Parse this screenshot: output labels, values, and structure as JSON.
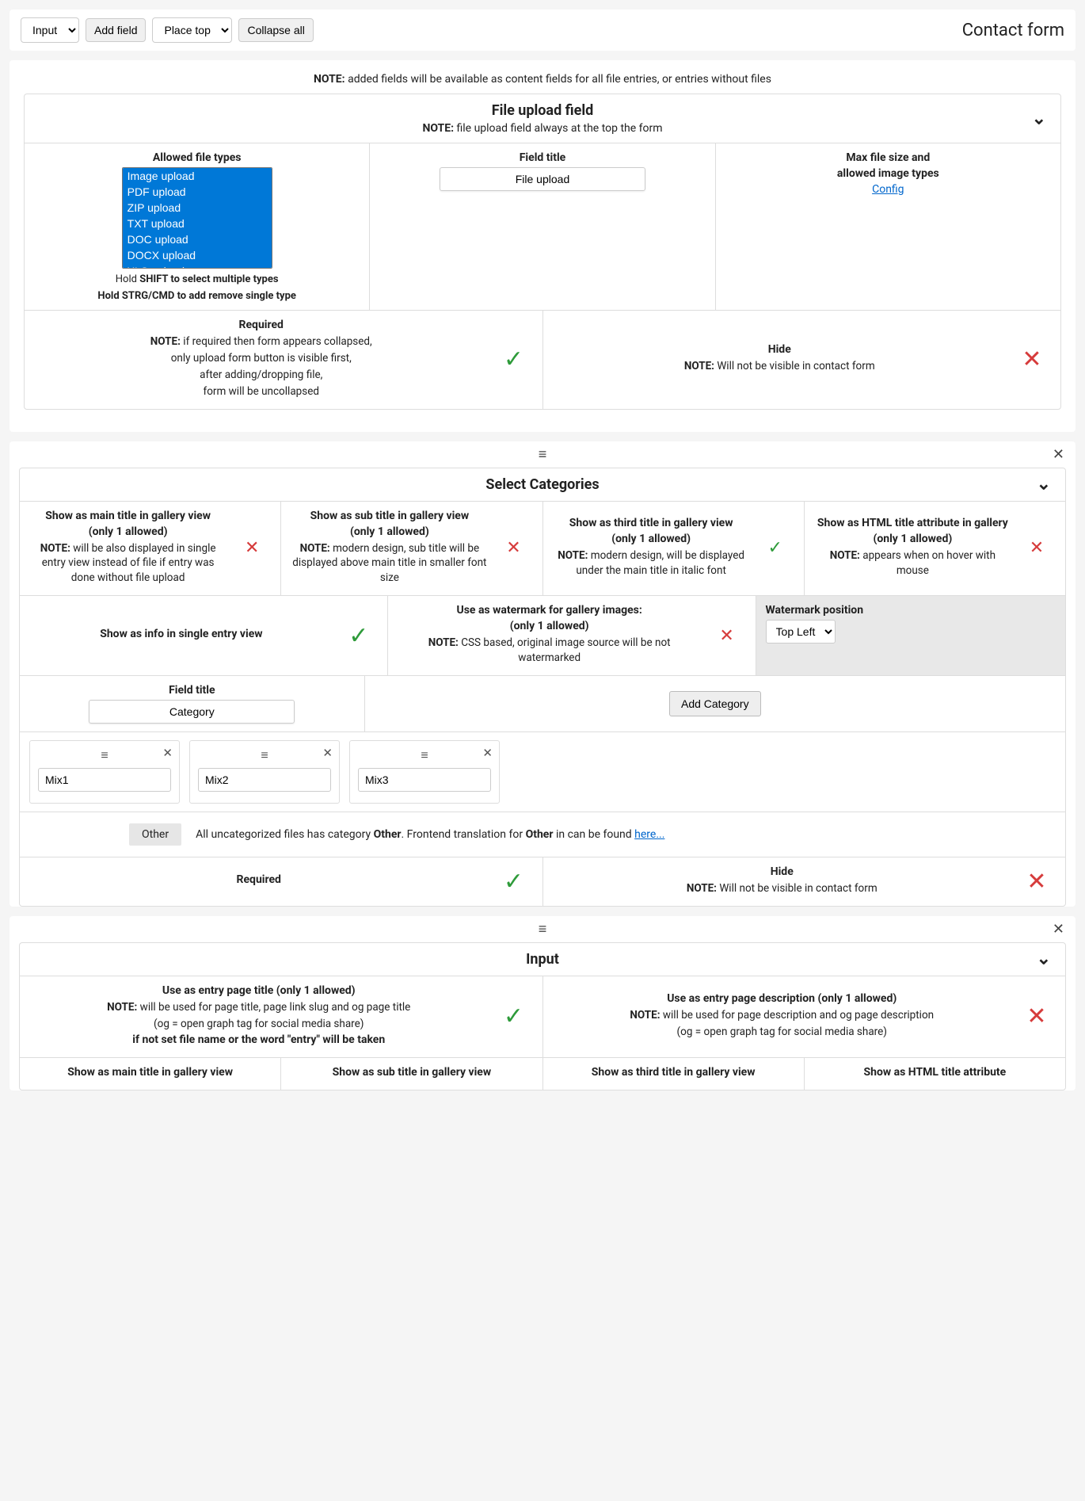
{
  "toolbar": {
    "field_type": "Input",
    "add_field": "Add field",
    "place": "Place top",
    "collapse": "Collapse all",
    "page_title": "Contact form"
  },
  "global_note_label": "NOTE:",
  "global_note": " added fields will be available as content fields for all file entries, or entries without files",
  "file_upload": {
    "header": "File upload field",
    "sub_note": " file upload field always at the top the form",
    "allowed_label": "Allowed file types",
    "types": [
      "Image upload",
      "PDF upload",
      "ZIP upload",
      "TXT upload",
      "DOC upload",
      "DOCX upload",
      "XLS upload"
    ],
    "hint1_a": "Hold ",
    "hint1_b": "SHIFT",
    "hint1_c": " to select multiple types",
    "hint2_a": "Hold ",
    "hint2_b": "STRG/CMD",
    "hint2_c": " to add remove single type",
    "field_title_label": "Field title",
    "field_title_value": "File upload",
    "max_label1": "Max file size and",
    "max_label2": "allowed image types",
    "config_link": "Config",
    "required_label": "Required",
    "required_note1": " if required then form appears collapsed,",
    "required_note2": "only upload form button is visible first,",
    "required_note3": "after adding/dropping file,",
    "required_note4": "form will be uncollapsed",
    "hide_label": "Hide",
    "hide_note": " Will not be visible in contact form"
  },
  "categories": {
    "header": "Select Categories",
    "c1_t1": "Show as main title in gallery view",
    "c1_t2": "(only 1 allowed)",
    "c1_note": " will be also displayed in single entry view instead of file if entry was done without file upload",
    "c2_t1": "Show as sub title in gallery view",
    "c2_t2": "(only 1 allowed)",
    "c2_note": " modern design, sub title will be displayed above main title in smaller font size",
    "c3_t1": "Show as third title in gallery view",
    "c3_t2": "(only 1 allowed)",
    "c3_note": " modern design, will be displayed under the main title in italic font",
    "c4_t1": "Show as HTML title attribute in gallery",
    "c4_t2": "(only 1 allowed)",
    "c4_note": " appears when on hover with mouse",
    "c5_title": "Show as info in single entry view",
    "c6_t1": "Use as watermark for gallery images:",
    "c6_t2": "(only 1 allowed)",
    "c6_note": " CSS based, original image source will be not watermarked",
    "c7_title": "Watermark position",
    "c7_value": "Top Left",
    "field_title_label": "Field title",
    "field_title_value": "Category",
    "add_btn": "Add Category",
    "cats": [
      "Mix1",
      "Mix2",
      "Mix3"
    ],
    "other_tag": "Other",
    "other_text_a": "All uncategorized files has category ",
    "other_text_b": "Other",
    "other_text_c": ". Frontend translation for ",
    "other_text_d": "Other",
    "other_text_e": " in can be found ",
    "other_link": "here...",
    "required_label": "Required",
    "hide_label": "Hide",
    "hide_note": " Will not be visible in contact form"
  },
  "input": {
    "header": "Input",
    "c1_t1": "Use as entry page title (only 1 allowed)",
    "c1_note1": " will be used for page title, page link slug and og page title",
    "c1_note2": "(og = open graph tag for social media share)",
    "c1_note3": "if not set file name or the word \"entry\" will be taken",
    "c2_t1": "Use as entry page description (only 1 allowed)",
    "c2_note1": " will be used for page description and og page description",
    "c2_note2": "(og = open graph tag for social media share)",
    "r2c1": "Show as main title in gallery view",
    "r2c2": "Show as sub title in gallery view",
    "r2c3": "Show as third title in gallery view",
    "r2c4": "Show as HTML title attribute"
  }
}
